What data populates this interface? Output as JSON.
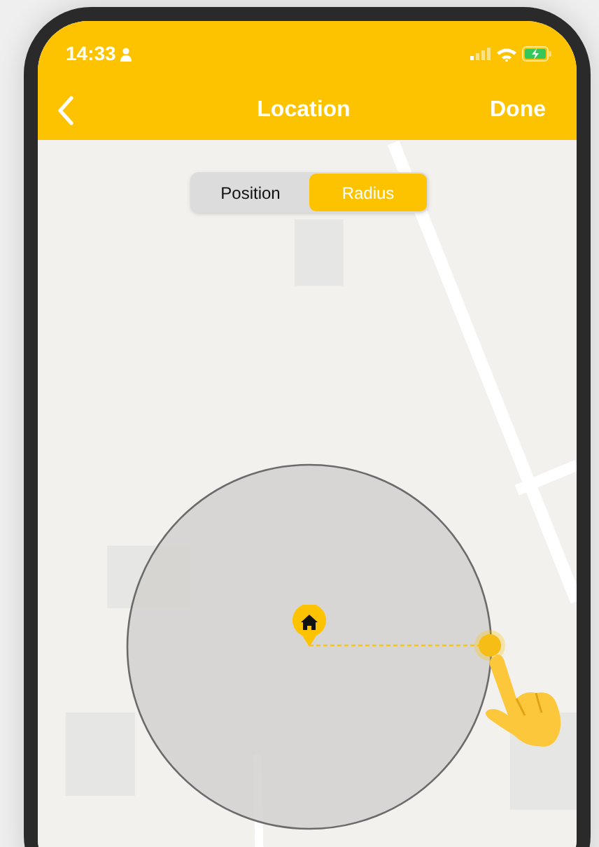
{
  "status_bar": {
    "time": "14:33"
  },
  "nav_bar": {
    "title": "Location",
    "action": "Done"
  },
  "segmented_control": [
    {
      "label": "Position",
      "selected": false
    },
    {
      "label": "Radius",
      "selected": true
    }
  ]
}
